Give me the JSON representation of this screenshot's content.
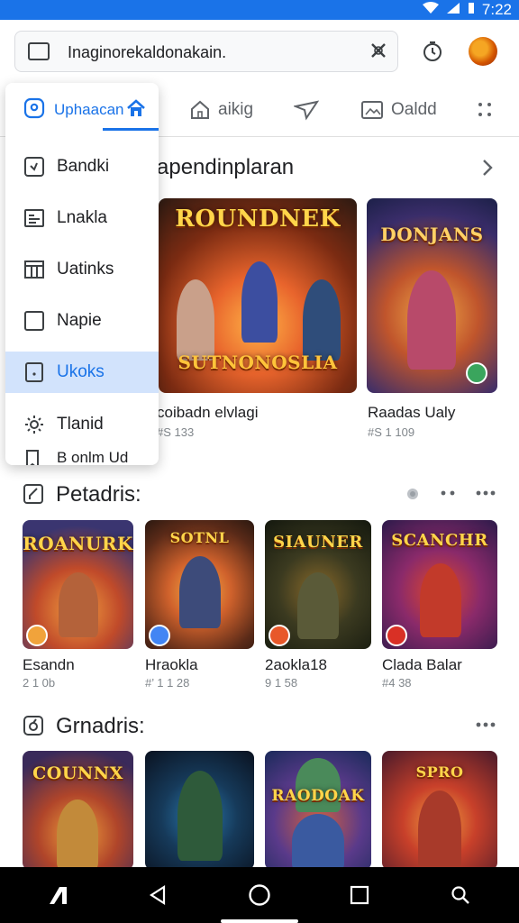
{
  "status_bar": {
    "time": "7:22"
  },
  "search": {
    "query": "Inaginorekaldonakain."
  },
  "tabs": [
    {
      "label": "Uphaacan",
      "icon": "location-pin-icon"
    },
    {
      "label": "aikig",
      "icon": "house-icon"
    },
    {
      "label": "",
      "icon": "send-icon"
    },
    {
      "label": "Oaldd",
      "icon": "image-icon"
    }
  ],
  "menu": {
    "header": "Uphaacan",
    "items": [
      {
        "label": "Bandki",
        "icon": "checkbox-icon"
      },
      {
        "label": "Lnakla",
        "icon": "list-icon"
      },
      {
        "label": "Uatinks",
        "icon": "table-icon"
      },
      {
        "label": "Napie",
        "icon": "square-icon"
      },
      {
        "label": "Ukoks",
        "icon": "document-icon",
        "selected": true
      },
      {
        "label": "Tlanid",
        "icon": "gear-icon"
      },
      {
        "label": "B onlm Ud",
        "icon": "bookmark-icon"
      }
    ]
  },
  "featured": {
    "title": "apendinplaran",
    "cards": [
      {
        "logo": "ROUNDNEK",
        "logo_sub": "SUTNONOSLIA",
        "title": "coibadn elvlagi",
        "sub": "#S 133"
      },
      {
        "logo": "DONJANS",
        "title": "Raadas Ualy",
        "sub": "#S 1 109"
      }
    ]
  },
  "section2": {
    "title": "Petadris:",
    "cards": [
      {
        "logo": "ROANURK",
        "title": "Esandn",
        "sub": "2 1 0b"
      },
      {
        "logo": "SOTNL",
        "title": "Hraokla",
        "sub": "#’ 1 1 28"
      },
      {
        "logo": "SIAUNER",
        "title": "2aokla18",
        "sub": "9 1 58"
      },
      {
        "logo": "SCANCHR",
        "title": "Clada Balar",
        "sub": "#4 38"
      }
    ]
  },
  "section3": {
    "title": "Grnadris:",
    "cards": [
      {
        "logo": "COUNNX"
      },
      {
        "logo": ""
      },
      {
        "logo": "RAODOAK"
      },
      {
        "logo": "SPRO"
      }
    ]
  }
}
